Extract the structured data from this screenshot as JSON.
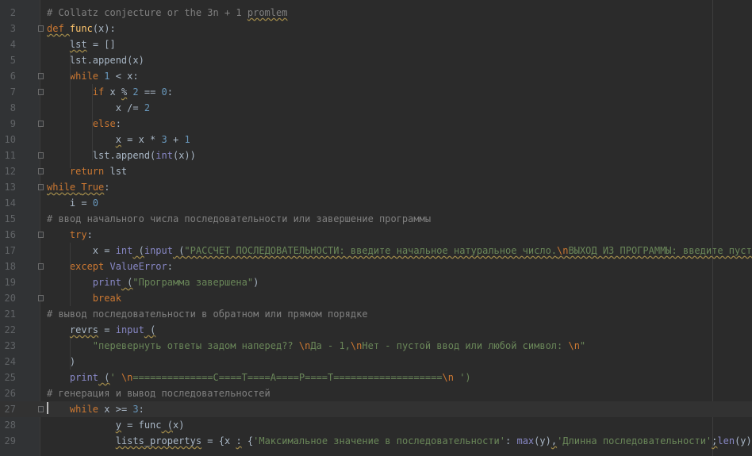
{
  "editor": {
    "lines": [
      {
        "n": "2",
        "tokens": [
          {
            "t": "# Collatz conjecture or the 3n + 1 ",
            "c": "cm"
          },
          {
            "t": "promlem",
            "c": "cm wavy"
          }
        ]
      },
      {
        "n": "3",
        "tokens": [
          {
            "t": "def ",
            "c": "kw wavy"
          },
          {
            "t": "func",
            "c": "fn"
          },
          {
            "t": "(x):",
            "c": ""
          }
        ]
      },
      {
        "n": "4",
        "tokens": [
          {
            "t": "    ",
            "c": ""
          },
          {
            "t": "lst",
            "c": "wavy"
          },
          {
            "t": " = []",
            "c": ""
          }
        ]
      },
      {
        "n": "5",
        "tokens": [
          {
            "t": "    lst.append(x)",
            "c": ""
          }
        ]
      },
      {
        "n": "6",
        "tokens": [
          {
            "t": "    ",
            "c": ""
          },
          {
            "t": "while ",
            "c": "kw"
          },
          {
            "t": "1",
            "c": "num"
          },
          {
            "t": " < x:",
            "c": ""
          }
        ]
      },
      {
        "n": "7",
        "tokens": [
          {
            "t": "        ",
            "c": ""
          },
          {
            "t": "if ",
            "c": "kw"
          },
          {
            "t": "x ",
            "c": ""
          },
          {
            "t": "%",
            "c": "wavy"
          },
          {
            "t": " ",
            "c": ""
          },
          {
            "t": "2",
            "c": "num"
          },
          {
            "t": " == ",
            "c": ""
          },
          {
            "t": "0",
            "c": "num"
          },
          {
            "t": ":",
            "c": ""
          }
        ]
      },
      {
        "n": "8",
        "tokens": [
          {
            "t": "            x /= ",
            "c": ""
          },
          {
            "t": "2",
            "c": "num"
          }
        ]
      },
      {
        "n": "9",
        "tokens": [
          {
            "t": "        ",
            "c": ""
          },
          {
            "t": "else",
            "c": "kw"
          },
          {
            "t": ":",
            "c": ""
          }
        ]
      },
      {
        "n": "10",
        "tokens": [
          {
            "t": "            ",
            "c": ""
          },
          {
            "t": "x",
            "c": "wavy"
          },
          {
            "t": " = x * ",
            "c": ""
          },
          {
            "t": "3",
            "c": "num"
          },
          {
            "t": " + ",
            "c": ""
          },
          {
            "t": "1",
            "c": "num"
          }
        ]
      },
      {
        "n": "11",
        "tokens": [
          {
            "t": "        lst.append(",
            "c": ""
          },
          {
            "t": "int",
            "c": "bi"
          },
          {
            "t": "(x))",
            "c": ""
          }
        ]
      },
      {
        "n": "12",
        "tokens": [
          {
            "t": "    ",
            "c": ""
          },
          {
            "t": "return ",
            "c": "kw"
          },
          {
            "t": "lst",
            "c": ""
          }
        ]
      },
      {
        "n": "13",
        "tokens": [
          {
            "t": "while ",
            "c": "kw wavy"
          },
          {
            "t": "True",
            "c": "kw wavy"
          },
          {
            "t": ":",
            "c": ""
          }
        ]
      },
      {
        "n": "14",
        "tokens": [
          {
            "t": "    i = ",
            "c": ""
          },
          {
            "t": "0",
            "c": "num"
          }
        ]
      },
      {
        "n": "15",
        "tokens": [
          {
            "t": "# ввод начального числа последовательности или завершение программы",
            "c": "cm"
          }
        ]
      },
      {
        "n": "16",
        "tokens": [
          {
            "t": "    ",
            "c": ""
          },
          {
            "t": "try",
            "c": "kw"
          },
          {
            "t": ":",
            "c": ""
          }
        ]
      },
      {
        "n": "17",
        "tokens": [
          {
            "t": "        x = ",
            "c": ""
          },
          {
            "t": "int",
            "c": "bi"
          },
          {
            "t": " (",
            "c": "wavy"
          },
          {
            "t": "input",
            "c": "bi"
          },
          {
            "t": " (",
            "c": "wavy"
          },
          {
            "t": "\"РАССЧЕТ ПОСЛЕДОВАТЕЛЬНОСТИ: введите начальное натуральное число.",
            "c": "str wavy"
          },
          {
            "t": "\\n",
            "c": "esc wavy"
          },
          {
            "t": "ВЫХОД ИЗ ПРОГРАММЫ: введите пустой в",
            "c": "str wavy"
          }
        ]
      },
      {
        "n": "18",
        "tokens": [
          {
            "t": "    ",
            "c": ""
          },
          {
            "t": "except ",
            "c": "kw"
          },
          {
            "t": "ValueError",
            "c": "bi"
          },
          {
            "t": ":",
            "c": ""
          }
        ]
      },
      {
        "n": "19",
        "tokens": [
          {
            "t": "        ",
            "c": ""
          },
          {
            "t": "print",
            "c": "bi"
          },
          {
            "t": " (",
            "c": "wavy"
          },
          {
            "t": "\"Программа завершена\"",
            "c": "str"
          },
          {
            "t": ")",
            "c": ""
          }
        ]
      },
      {
        "n": "20",
        "tokens": [
          {
            "t": "        ",
            "c": ""
          },
          {
            "t": "break",
            "c": "kw"
          }
        ]
      },
      {
        "n": "21",
        "tokens": [
          {
            "t": "# вывод последовательности в обратном или прямом порядке",
            "c": "cm"
          }
        ]
      },
      {
        "n": "22",
        "tokens": [
          {
            "t": "    ",
            "c": ""
          },
          {
            "t": "revrs",
            "c": "wavy"
          },
          {
            "t": " = ",
            "c": ""
          },
          {
            "t": "input",
            "c": "bi"
          },
          {
            "t": " (",
            "c": "wavy"
          }
        ]
      },
      {
        "n": "23",
        "tokens": [
          {
            "t": "        ",
            "c": ""
          },
          {
            "t": "\"перевернуть ответы задом наперед?? ",
            "c": "str"
          },
          {
            "t": "\\n",
            "c": "esc"
          },
          {
            "t": "Да - 1,",
            "c": "str"
          },
          {
            "t": "\\n",
            "c": "esc"
          },
          {
            "t": "Нет - пустой ввод или любой символ: ",
            "c": "str"
          },
          {
            "t": "\\n",
            "c": "esc"
          },
          {
            "t": "\"",
            "c": "str"
          }
        ]
      },
      {
        "n": "24",
        "tokens": [
          {
            "t": "    )",
            "c": ""
          }
        ]
      },
      {
        "n": "25",
        "tokens": [
          {
            "t": "    ",
            "c": ""
          },
          {
            "t": "print",
            "c": "bi"
          },
          {
            "t": " (",
            "c": "wavy"
          },
          {
            "t": "' ",
            "c": "str"
          },
          {
            "t": "\\n",
            "c": "esc"
          },
          {
            "t": "==============С====Т====А====Р====Т===================",
            "c": "str"
          },
          {
            "t": "\\n",
            "c": "esc"
          },
          {
            "t": " ')",
            "c": "str"
          }
        ]
      },
      {
        "n": "26",
        "tokens": [
          {
            "t": "# генерация и вывод последовательностей",
            "c": "cm"
          }
        ]
      },
      {
        "n": "27",
        "tokens": [
          {
            "t": "    ",
            "c": ""
          },
          {
            "t": "while ",
            "c": "kw"
          },
          {
            "t": "x >= ",
            "c": ""
          },
          {
            "t": "3",
            "c": "num"
          },
          {
            "t": ":",
            "c": ""
          }
        ]
      },
      {
        "n": "28",
        "tokens": [
          {
            "t": "            ",
            "c": ""
          },
          {
            "t": "y",
            "c": "wavy"
          },
          {
            "t": " = func",
            "c": ""
          },
          {
            "t": " (",
            "c": "wavy"
          },
          {
            "t": "x)",
            "c": ""
          }
        ]
      },
      {
        "n": "29",
        "tokens": [
          {
            "t": "            ",
            "c": ""
          },
          {
            "t": "lists_propertys",
            "c": "wavy"
          },
          {
            "t": " = {x ",
            "c": ""
          },
          {
            "t": ":",
            "c": "wavy"
          },
          {
            "t": " {",
            "c": ""
          },
          {
            "t": "'Максимальное значение в последовательности'",
            "c": "str"
          },
          {
            "t": ": ",
            "c": ""
          },
          {
            "t": "max",
            "c": "bi"
          },
          {
            "t": "(y)",
            "c": ""
          },
          {
            "t": ",",
            "c": "wavy"
          },
          {
            "t": "'Длинна последовательности'",
            "c": "str"
          },
          {
            "t": ";",
            "c": "wavy"
          },
          {
            "t": "len",
            "c": "bi"
          },
          {
            "t": "(y)}}",
            "c": ""
          }
        ]
      }
    ]
  }
}
